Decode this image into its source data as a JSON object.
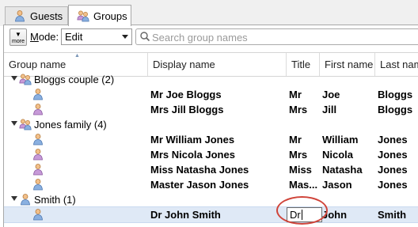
{
  "tabs": [
    {
      "label": "Guests",
      "icon": "guest-person-icon",
      "active": false
    },
    {
      "label": "Groups",
      "icon": "group-people-icon",
      "active": true
    }
  ],
  "toolbar": {
    "more_label": "more",
    "mode_label": "Mode:",
    "mode_value": "Edit",
    "search_placeholder": "Search group names"
  },
  "columns": [
    "Group name",
    "Display name",
    "Title",
    "First name",
    "Last nam"
  ],
  "groups": [
    {
      "label": "Bloggs couple (2)",
      "members": [
        {
          "display": "Mr Joe Bloggs",
          "title": "Mr",
          "first": "Joe",
          "last": "Bloggs"
        },
        {
          "display": "Mrs Jill Bloggs",
          "title": "Mrs",
          "first": "Jill",
          "last": "Bloggs"
        }
      ]
    },
    {
      "label": "Jones family (4)",
      "members": [
        {
          "display": "Mr William Jones",
          "title": "Mr",
          "first": "William",
          "last": "Jones"
        },
        {
          "display": "Mrs Nicola Jones",
          "title": "Mrs",
          "first": "Nicola",
          "last": "Jones"
        },
        {
          "display": "Miss Natasha Jones",
          "title": "Miss",
          "first": "Natasha",
          "last": "Jones"
        },
        {
          "display": "Master Jason Jones",
          "title": "Mas...",
          "first": "Jason",
          "last": "Jones"
        }
      ]
    },
    {
      "label": "Smith (1)",
      "members": [
        {
          "display": "Dr John Smith",
          "title": "Dr",
          "first": "John",
          "last": "Smith",
          "editing": true
        }
      ]
    }
  ],
  "colors": {
    "selected_row": "#dfe9f6",
    "callout": "#d0443a"
  }
}
